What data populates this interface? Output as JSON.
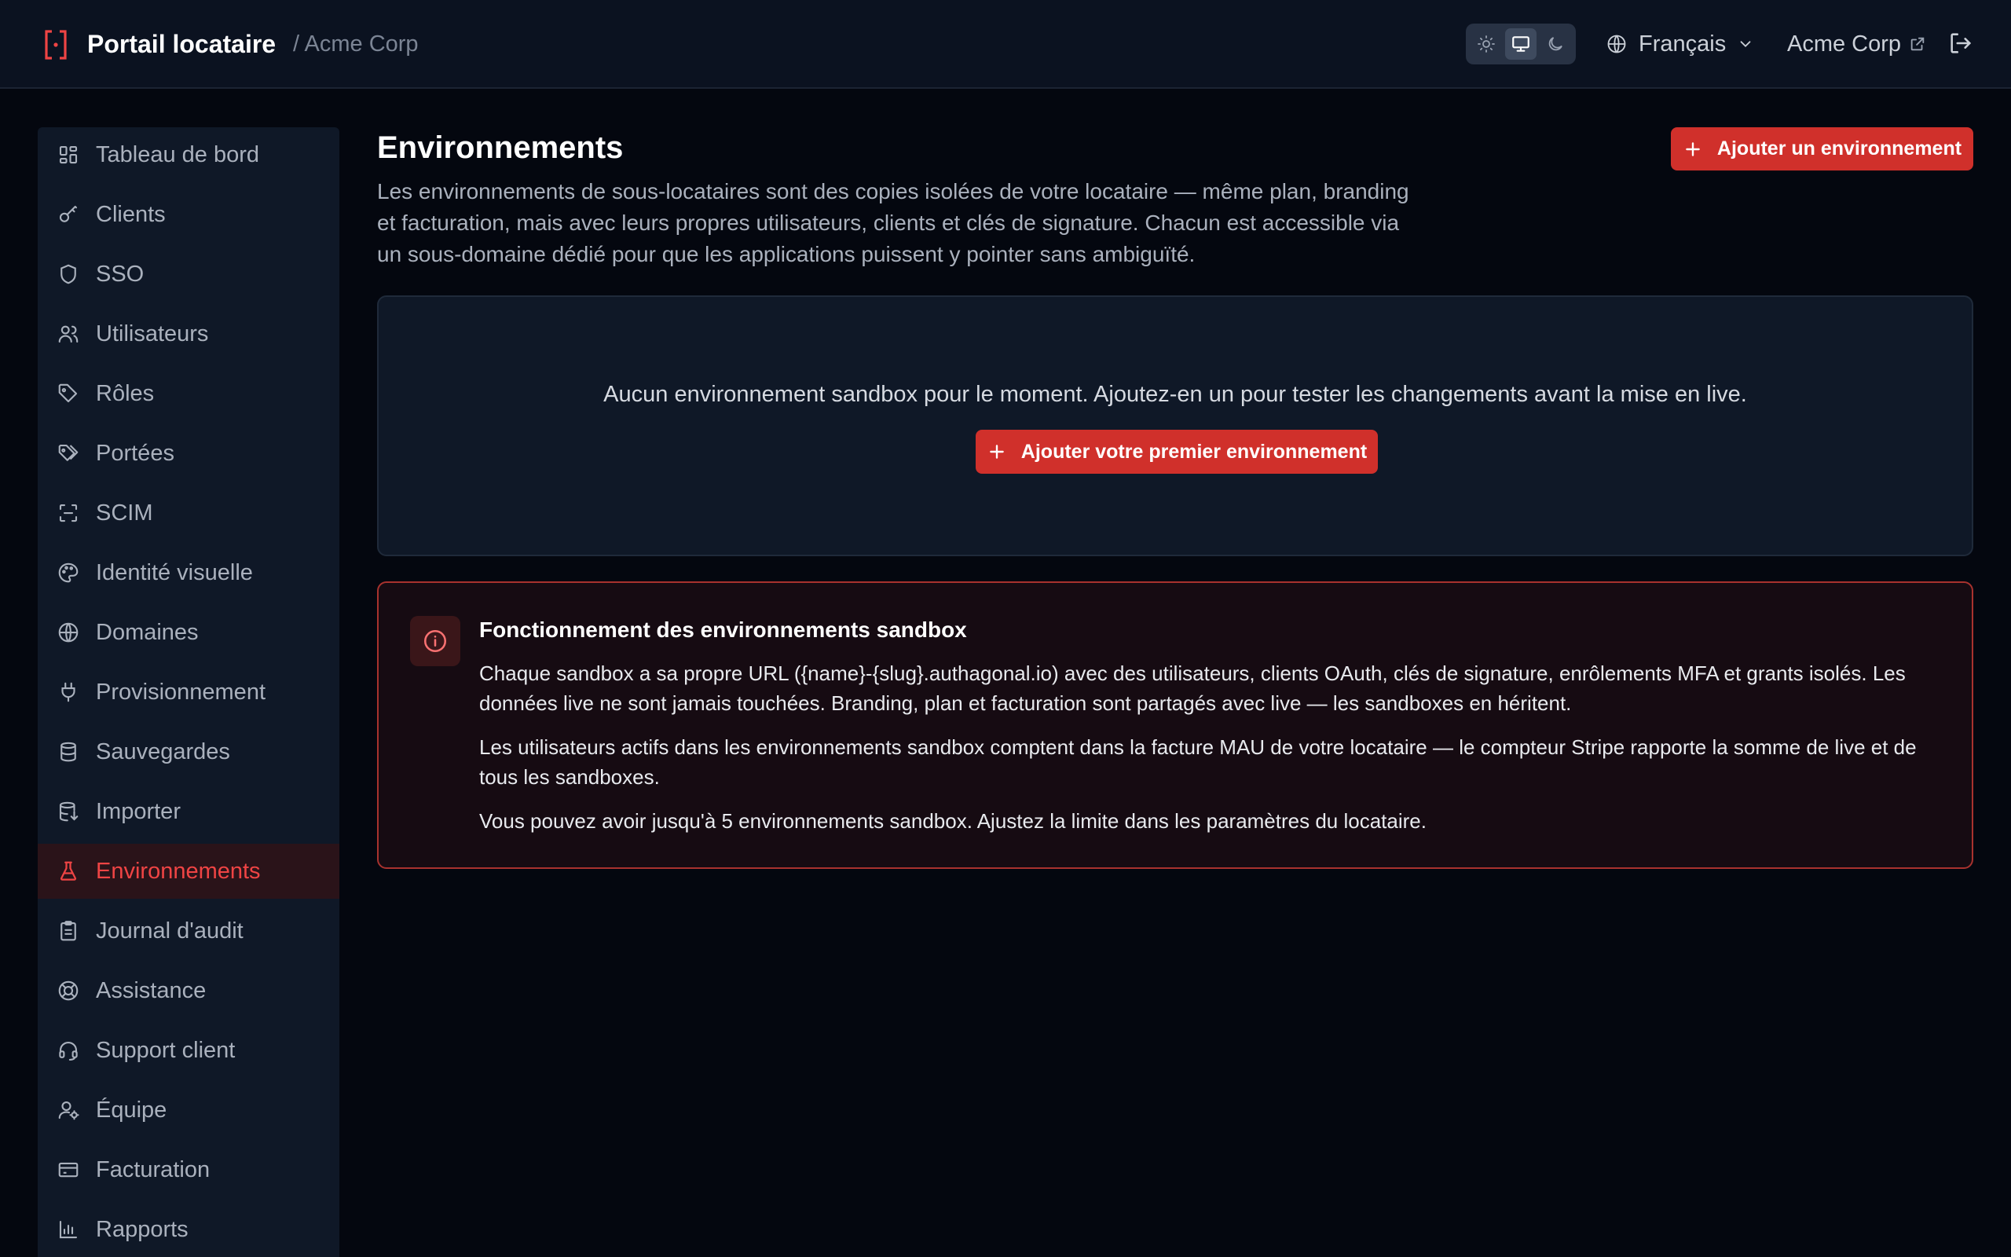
{
  "header": {
    "app_title": "Portail locataire",
    "breadcrumb": "/ Acme Corp",
    "theme_options": [
      "light",
      "system",
      "dark"
    ],
    "theme_selected": "system",
    "language": "Français",
    "tenant_link": "Acme Corp"
  },
  "sidebar": {
    "items": [
      {
        "label": "Tableau de bord",
        "icon": "dashboard-icon"
      },
      {
        "label": "Clients",
        "icon": "key-icon"
      },
      {
        "label": "SSO",
        "icon": "shield-icon"
      },
      {
        "label": "Utilisateurs",
        "icon": "users-icon"
      },
      {
        "label": "Rôles",
        "icon": "tag-icon"
      },
      {
        "label": "Portées",
        "icon": "tags-icon"
      },
      {
        "label": "SCIM",
        "icon": "scan-icon"
      },
      {
        "label": "Identité visuelle",
        "icon": "palette-icon"
      },
      {
        "label": "Domaines",
        "icon": "globe-icon"
      },
      {
        "label": "Provisionnement",
        "icon": "plug-icon"
      },
      {
        "label": "Sauvegardes",
        "icon": "database-icon"
      },
      {
        "label": "Importer",
        "icon": "database-import-icon"
      },
      {
        "label": "Environnements",
        "icon": "flask-icon",
        "active": true
      },
      {
        "label": "Journal d'audit",
        "icon": "clipboard-icon"
      },
      {
        "label": "Assistance",
        "icon": "lifebuoy-icon"
      },
      {
        "label": "Support client",
        "icon": "headset-icon"
      },
      {
        "label": "Équipe",
        "icon": "user-cog-icon"
      },
      {
        "label": "Facturation",
        "icon": "credit-card-icon"
      },
      {
        "label": "Rapports",
        "icon": "bar-chart-icon"
      }
    ]
  },
  "main": {
    "title": "Environnements",
    "description": "Les environnements de sous-locataires sont des copies isolées de votre locataire — même plan, branding et facturation, mais avec leurs propres utilisateurs, clients et clés de signature. Chacun est accessible via un sous-domaine dédié pour que les applications puissent y pointer sans ambiguïté.",
    "add_button": "Ajouter un environnement",
    "empty_state": {
      "text": "Aucun environnement sandbox pour le moment. Ajoutez-en un pour tester les changements avant la mise en live.",
      "button": "Ajouter votre premier environnement"
    },
    "info": {
      "title": "Fonctionnement des environnements sandbox",
      "paragraphs": [
        "Chaque sandbox a sa propre URL ({name}-{slug}.authagonal.io) avec des utilisateurs, clients OAuth, clés de signature, enrôlements MFA et grants isolés. Les données live ne sont jamais touchées. Branding, plan et facturation sont partagés avec live — les sandboxes en héritent.",
        "Les utilisateurs actifs dans les environnements sandbox comptent dans la facture MAU de votre locataire — le compteur Stripe rapporte la somme de live et de tous les sandboxes.",
        "Vous pouvez avoir jusqu'à 5 environnements sandbox. Ajustez la limite dans les paramètres du locataire."
      ]
    }
  },
  "colors": {
    "accent": "#d0302b",
    "active_nav_text": "#ef4444",
    "page_bg": "#04070f",
    "panel_bg": "#0f1827"
  }
}
